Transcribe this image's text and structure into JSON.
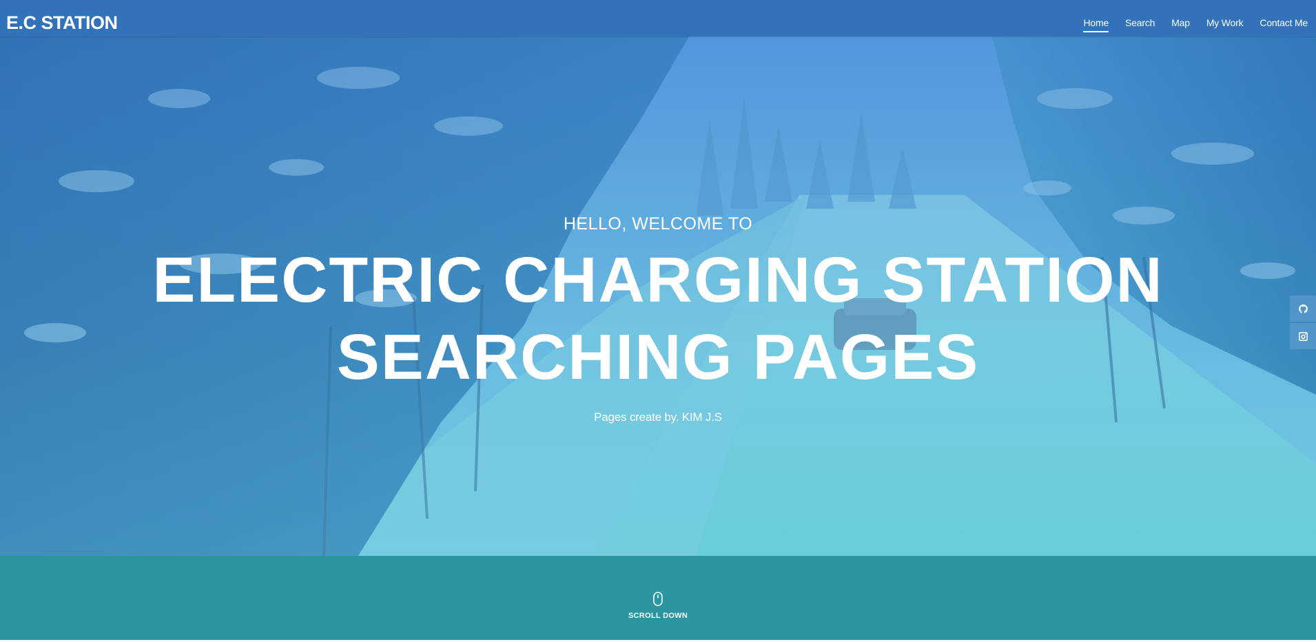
{
  "header": {
    "brand": "E.C STATION",
    "nav": [
      {
        "label": "Home",
        "active": true
      },
      {
        "label": "Search",
        "active": false
      },
      {
        "label": "Map",
        "active": false
      },
      {
        "label": "My Work",
        "active": false
      },
      {
        "label": "Contact Me",
        "active": false
      }
    ]
  },
  "hero": {
    "kicker": "HELLO, WELCOME TO",
    "title": "ELECTRIC CHARGING STATION SEARCHING PAGES",
    "subtitle": "Pages create by. KIM J.S"
  },
  "social": [
    {
      "icon": "github-icon"
    },
    {
      "icon": "instagram-icon"
    }
  ],
  "scroll": {
    "label": "SCROLL DOWN",
    "icon": "mouse-icon"
  },
  "colors": {
    "navbar": "#3172b8",
    "hero_top": "#3f87c9",
    "hero_bottom": "#5dc3d8",
    "scroll_band": "#2b95a0",
    "text": "#ffffff"
  }
}
